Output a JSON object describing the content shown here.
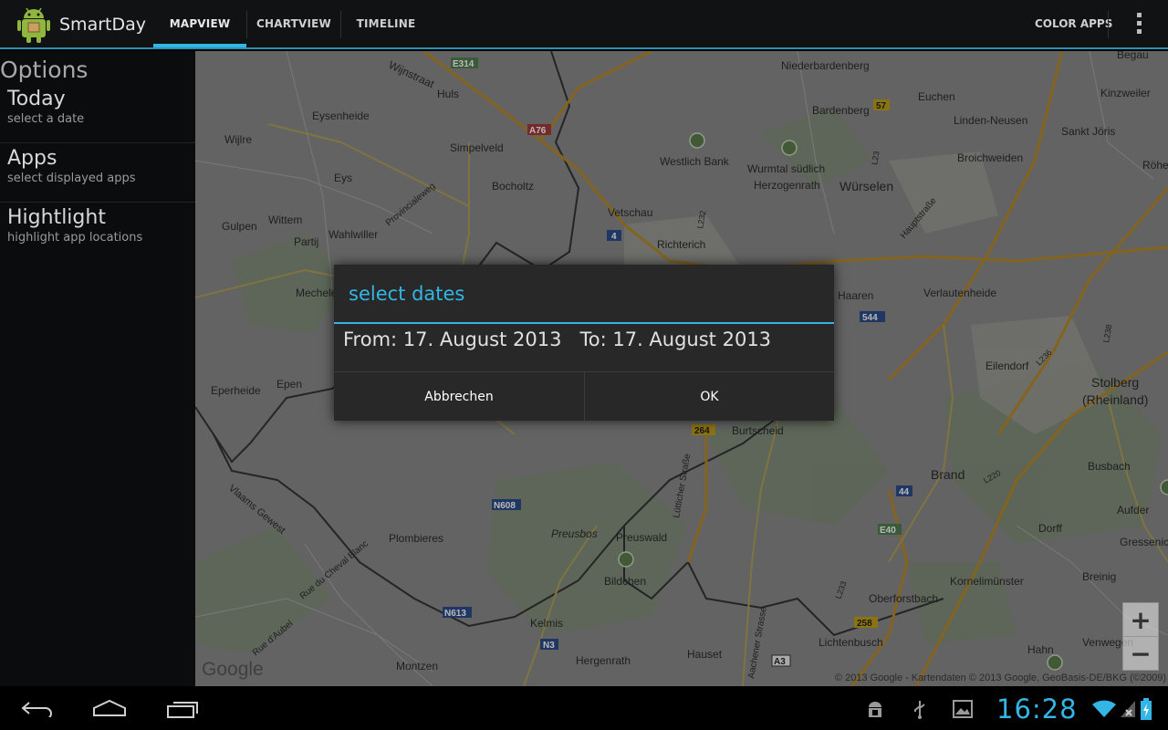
{
  "app": {
    "title": "SmartDay"
  },
  "tabs": [
    {
      "label": "MAPVIEW",
      "selected": true
    },
    {
      "label": "CHARTVIEW",
      "selected": false
    },
    {
      "label": "TIMELINE",
      "selected": false
    }
  ],
  "actions": {
    "color_apps": "COLOR APPS"
  },
  "options": {
    "title": "Options",
    "items": [
      {
        "title": "Today",
        "subtitle": "select a date"
      },
      {
        "title": "Apps",
        "subtitle": "select displayed apps"
      },
      {
        "title": "Hightlight",
        "subtitle": "highlight app locations"
      }
    ]
  },
  "dialog": {
    "title": "select dates",
    "from": "From: 17. August 2013",
    "to": "To: 17. August 2013",
    "cancel_label": "Abbrechen",
    "ok_label": "OK"
  },
  "map": {
    "labels": [
      "Wijnstraat",
      "E314",
      "Huls",
      "Eysenheide",
      "Wijlre",
      "Simpelveld",
      "Eys",
      "Bocholtz",
      "Gulpen",
      "Wittem",
      "Partij",
      "Wahlwiller",
      "Mechelen",
      "Epen",
      "Eperheide",
      "Vetschau",
      "Richterich",
      "Westlich Bank",
      "Wurmtal südlich",
      "Herzogenrath",
      "Würselen",
      "Niederbardenberg",
      "Bardenberg",
      "Euchen",
      "Linden-Neusen",
      "Sankt Jöris",
      "Kinzweiler",
      "Broichweiden",
      "Haaren",
      "Verlautenheide",
      "Eilendorf",
      "Stolberg",
      "(Rheinland)",
      "Burtscheid",
      "Brand",
      "Busbach",
      "Preusbos",
      "Preuswald",
      "Bildchen",
      "Plombieres",
      "Kelmis",
      "Hergenrath",
      "Hauset",
      "Montzen",
      "Oberforstbach",
      "Lichtenbusch",
      "Kornelimünster",
      "Dorff",
      "Breinig",
      "Hahn",
      "Venwegen",
      "Gressenich",
      "Aufder",
      "Röhe",
      "Begau",
      "N608",
      "N613",
      "N3",
      "A3",
      "A76",
      "E40",
      "44",
      "544",
      "264",
      "258",
      "57",
      "4",
      "Provincialeweg",
      "Hauptstraße",
      "Lütticher Straße",
      "Aachener Strasse",
      "Rue du Cheval Blanc",
      "Rue d'Aubel",
      "Vlaams Gewest",
      "L23",
      "L232",
      "L236",
      "L238",
      "L220",
      "L233"
    ],
    "zoom_in": "+",
    "zoom_out": "−",
    "google": "Google",
    "copyright": "© 2013 Google - Kartendaten © 2013 Google, GeoBasis-DE/BKG (©2009)"
  },
  "statusbar": {
    "time": "16:28"
  },
  "icons": {
    "app": "android-robot-icon",
    "back": "back-icon",
    "home": "home-icon",
    "recents": "recent-apps-icon",
    "debug": "android-debug-icon",
    "usb": "usb-icon",
    "gallery": "picture-icon",
    "wifi": "wifi-icon",
    "signal": "signal-off-icon",
    "battery": "battery-charging-icon"
  },
  "colors": {
    "accent": "#33b5e5",
    "actionbar": "#101214",
    "panel": "#0b0c0e",
    "dialog": "#282828"
  }
}
